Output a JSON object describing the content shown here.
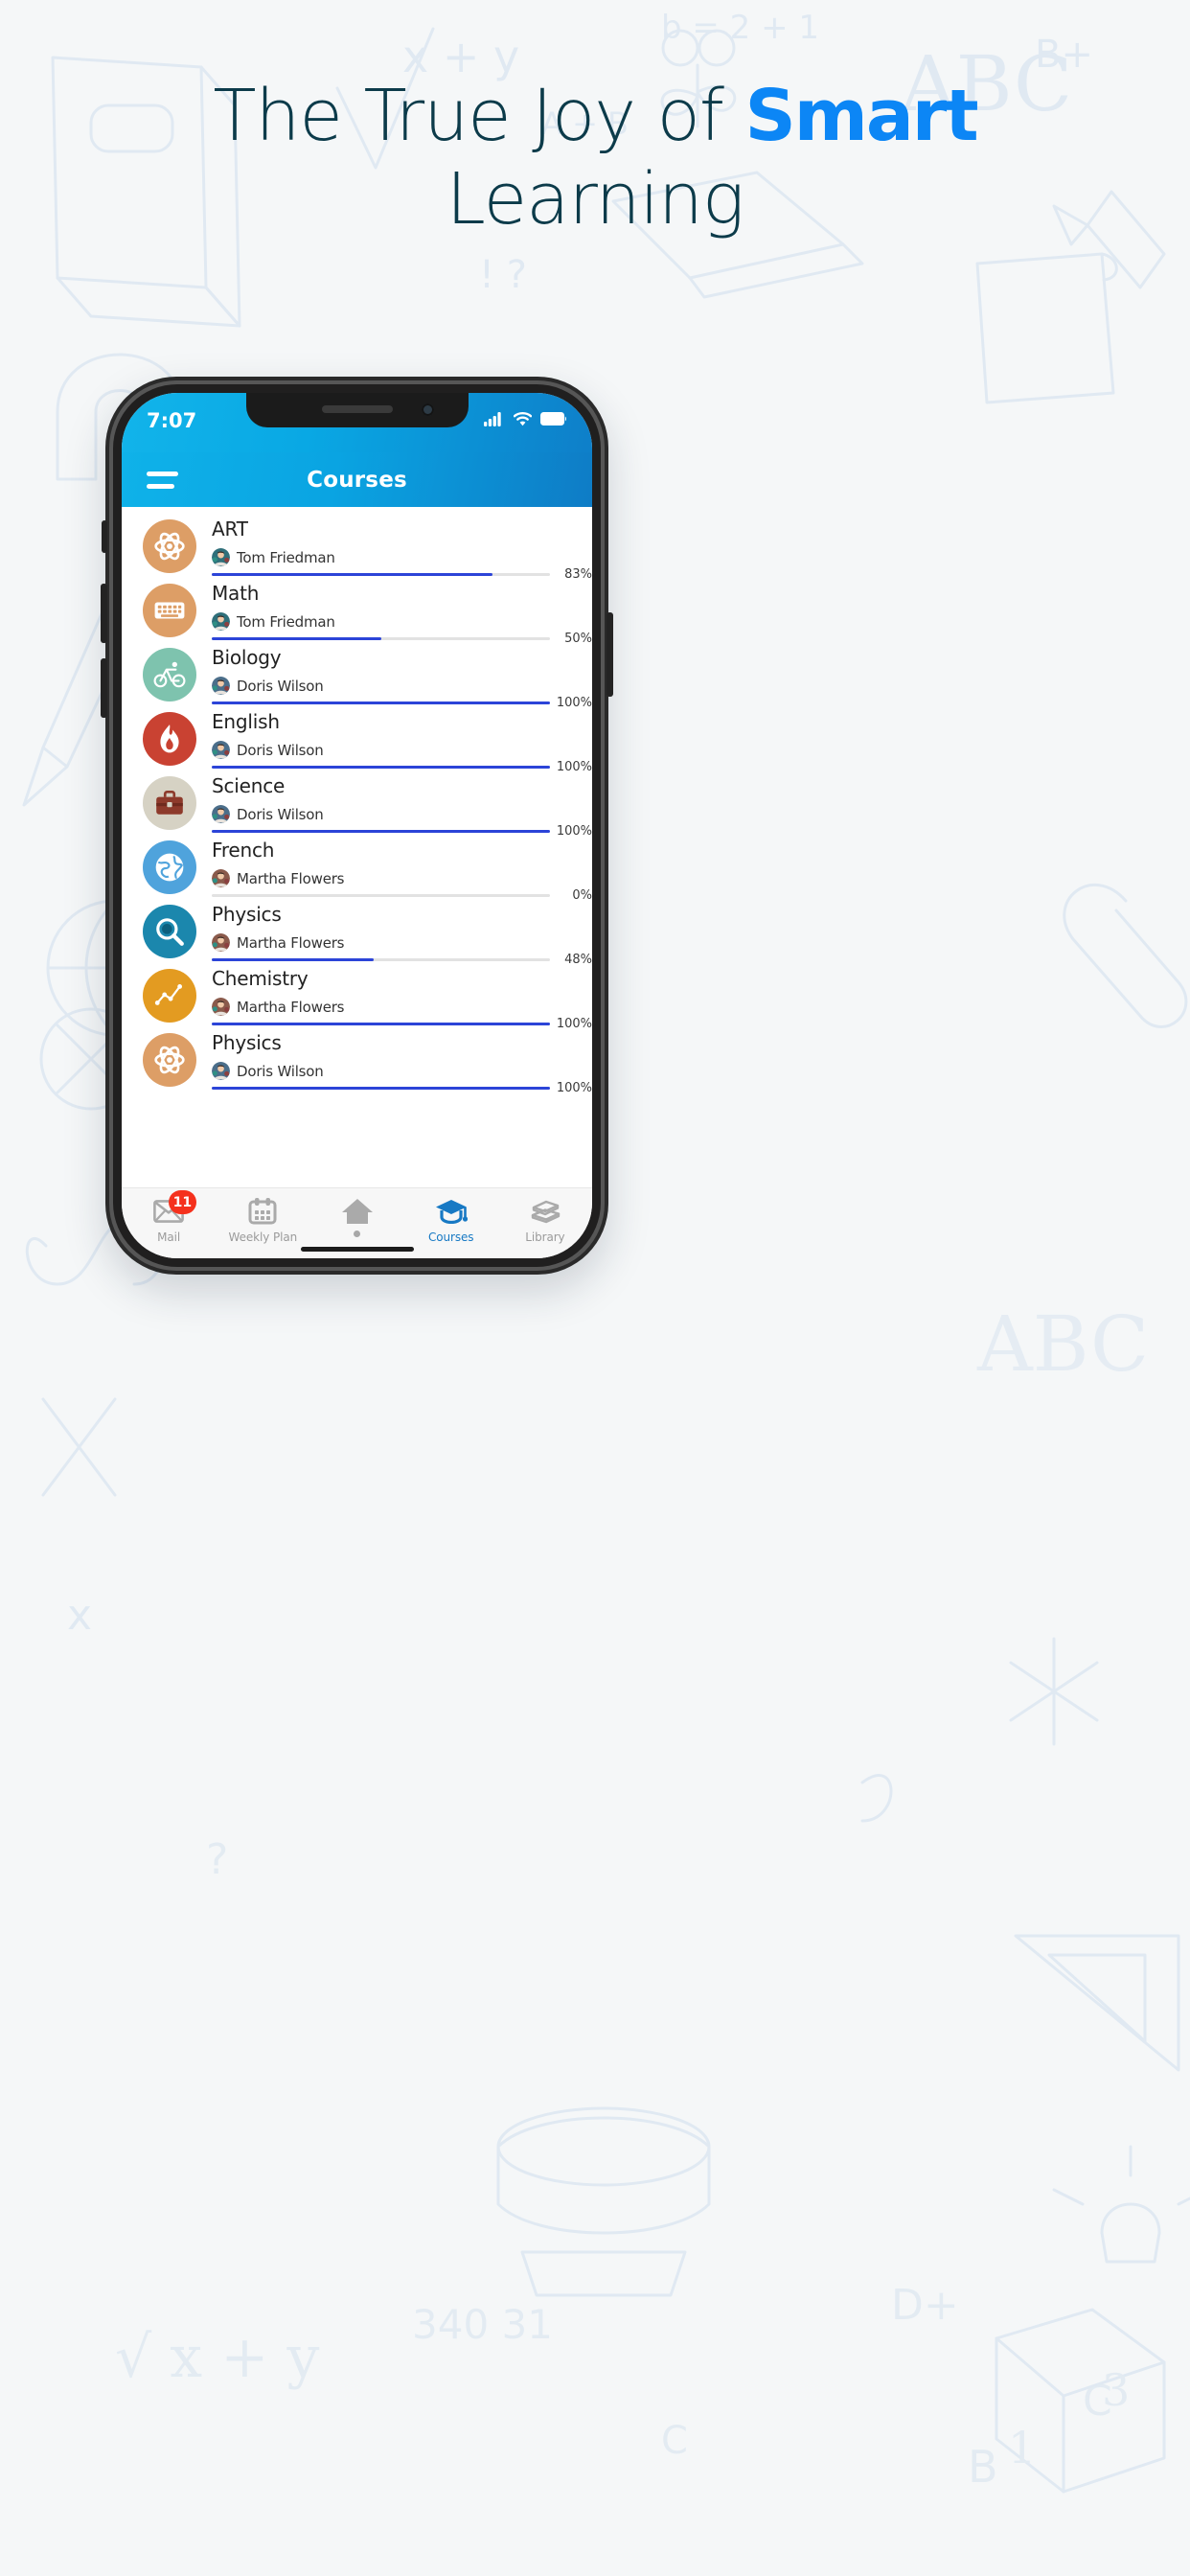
{
  "hero": {
    "line1_prefix": "The True Joy of ",
    "line1_accent": "Smart",
    "line2": "Learning",
    "accent_color": "#0c86f5",
    "text_color": "#0c3b4a"
  },
  "phone": {
    "status_bar": {
      "time": "7:07",
      "icons": [
        "signal-bars-icon",
        "wifi-icon",
        "battery-icon"
      ]
    },
    "app_bar": {
      "menu_icon": "hamburger-menu-icon",
      "title": "Courses",
      "gradient_from": "#0fb2e9",
      "gradient_to": "#0e7cc6"
    },
    "courses": [
      {
        "title": "ART",
        "teacher": "Tom Friedman",
        "percent": 83,
        "percent_label": "83%",
        "icon": "atom-icon",
        "icon_bg": "#dd9e66",
        "avatar_color": "#2f6f7a"
      },
      {
        "title": "Math",
        "teacher": "Tom Friedman",
        "percent": 50,
        "percent_label": "50%",
        "icon": "keyboard-icon",
        "icon_bg": "#dd9e66",
        "avatar_color": "#2f6f7a"
      },
      {
        "title": "Biology",
        "teacher": "Doris Wilson",
        "percent": 100,
        "percent_label": "100%",
        "icon": "bicycle-icon",
        "icon_bg": "#7ec3ae",
        "avatar_color": "#4b6e8a"
      },
      {
        "title": "English",
        "teacher": "Doris Wilson",
        "percent": 100,
        "percent_label": "100%",
        "icon": "flame-icon",
        "icon_bg": "#c94232",
        "avatar_color": "#4b6e8a"
      },
      {
        "title": "Science",
        "teacher": "Doris Wilson",
        "percent": 100,
        "percent_label": "100%",
        "icon": "briefcase-icon",
        "icon_bg": "#d6d2c4",
        "avatar_color": "#4b6e8a"
      },
      {
        "title": "French",
        "teacher": "Martha Flowers",
        "percent": 0,
        "percent_label": "0%",
        "icon": "globe-icon",
        "icon_bg": "#4fa3dc",
        "avatar_color": "#8a5a4b"
      },
      {
        "title": "Physics",
        "teacher": "Martha Flowers",
        "percent": 48,
        "percent_label": "48%",
        "icon": "magnifier-icon",
        "icon_bg": "#1b87ad",
        "avatar_color": "#8a5a4b"
      },
      {
        "title": "Chemistry",
        "teacher": "Martha Flowers",
        "percent": 100,
        "percent_label": "100%",
        "icon": "linechart-icon",
        "icon_bg": "#e39b21",
        "avatar_color": "#8a5a4b"
      },
      {
        "title": "Physics",
        "teacher": "Doris Wilson",
        "percent": 100,
        "percent_label": "100%",
        "icon": "atom-icon",
        "icon_bg": "#dd9e66",
        "avatar_color": "#4b6e8a"
      }
    ],
    "progress_color": "#2c44d8",
    "bottom_nav": [
      {
        "label": "Mail",
        "icon": "mail-icon",
        "badge": "11",
        "active": false
      },
      {
        "label": "Weekly Plan",
        "icon": "calendar-icon",
        "badge": null,
        "active": false
      },
      {
        "label": "",
        "icon": "home-icon",
        "badge": null,
        "active": false
      },
      {
        "label": "Courses",
        "icon": "graduation-cap-icon",
        "badge": null,
        "active": true
      },
      {
        "label": "Library",
        "icon": "books-icon",
        "badge": null,
        "active": false
      }
    ],
    "active_nav_color": "#1779c4",
    "badge_color": "#f5311d"
  }
}
